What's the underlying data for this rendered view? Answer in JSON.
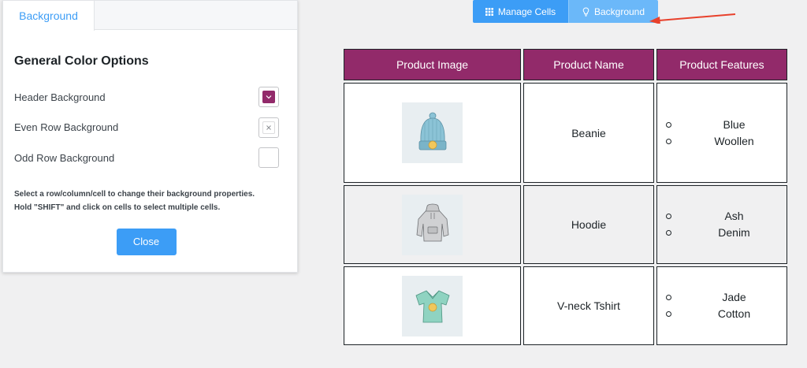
{
  "panel": {
    "tab_label": "Background",
    "section_title": "General Color Options",
    "options": [
      {
        "label": "Header Background",
        "state": "filled",
        "color": "#922a6a"
      },
      {
        "label": "Even Row Background",
        "state": "cleared"
      },
      {
        "label": "Odd Row Background",
        "state": "empty"
      }
    ],
    "help_text_line1": "Select a row/column/cell to change their background properties.",
    "help_text_line2": "Hold \"SHIFT\" and click on cells to select multiple cells.",
    "close_label": "Close"
  },
  "toolbar": {
    "manage_cells_label": "Manage Cells",
    "manage_cells_icon": "grid-icon",
    "background_label": "Background",
    "background_icon": "bulb-icon"
  },
  "table": {
    "headers": [
      "Product Image",
      "Product Name",
      "Product Features"
    ],
    "header_color": "#922a6a",
    "rows": [
      {
        "image_icon": "beanie-icon",
        "name": "Beanie",
        "features": [
          "Blue",
          "Woollen"
        ]
      },
      {
        "image_icon": "hoodie-icon",
        "name": "Hoodie",
        "features": [
          "Ash",
          "Denim"
        ]
      },
      {
        "image_icon": "tshirt-icon",
        "name": "V-neck Tshirt",
        "features": [
          "Jade",
          "Cotton"
        ]
      }
    ]
  },
  "colors": {
    "accent": "#3c9df6",
    "accent_light": "#6bb8f9",
    "annotation_arrow": "#e8412c",
    "even_row": "#f0f0f1"
  }
}
